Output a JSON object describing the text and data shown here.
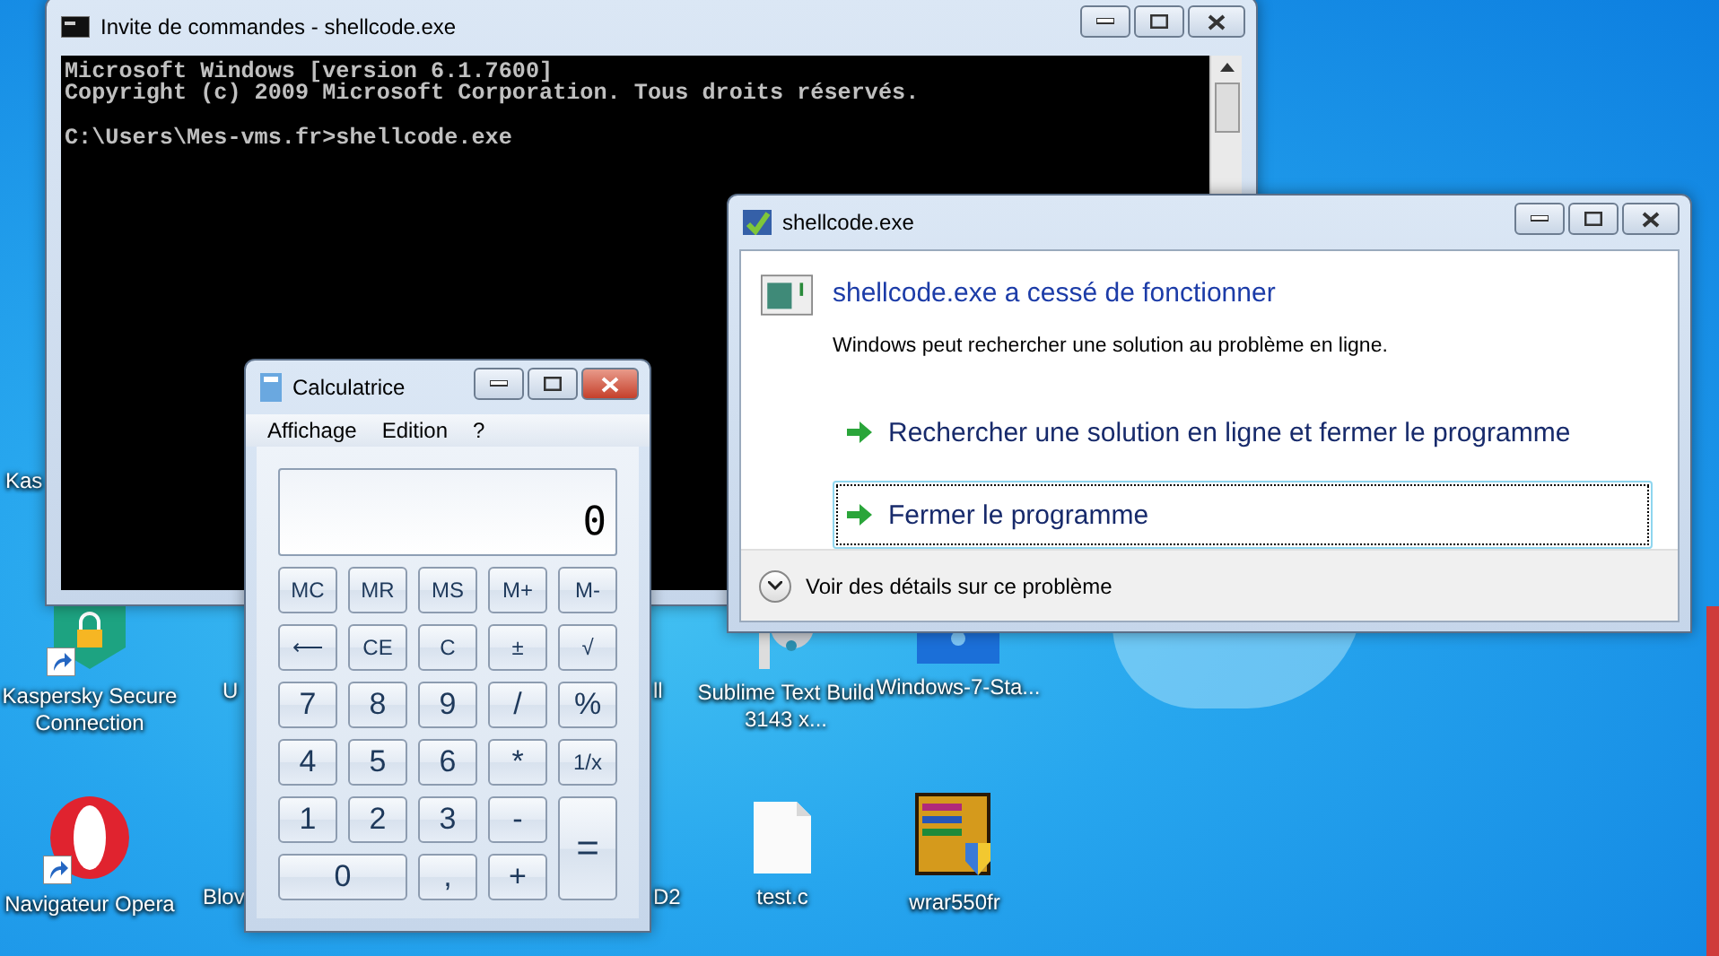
{
  "desktop": {
    "icons": [
      {
        "label": "Kaspersky Secure Connection",
        "kind": "kaspersky"
      },
      {
        "label": "Sublime Text Build 3143 x...",
        "kind": "disc"
      },
      {
        "label": "Windows-7-Sta...",
        "kind": "windows"
      },
      {
        "label": "Navigateur Opera",
        "kind": "opera"
      },
      {
        "label": "test.c",
        "kind": "file"
      },
      {
        "label": "wrar550fr",
        "kind": "archive"
      }
    ],
    "partial_labels": [
      "Kas",
      "U",
      "ll",
      "Blov",
      "D2"
    ]
  },
  "console": {
    "title": "Invite de commandes - shellcode.exe",
    "lines": [
      "Microsoft Windows [version 6.1.7600]",
      "Copyright (c) 2009 Microsoft Corporation. Tous droits réservés."
    ],
    "prompt": "C:\\Users\\Mes-vms.fr>shellcode.exe"
  },
  "calculator": {
    "title": "Calculatrice",
    "menu": [
      "Affichage",
      "Edition",
      "?"
    ],
    "display": "0",
    "buttons": [
      {
        "label": "MC",
        "kind": "normal"
      },
      {
        "label": "MR",
        "kind": "normal"
      },
      {
        "label": "MS",
        "kind": "normal"
      },
      {
        "label": "M+",
        "kind": "normal"
      },
      {
        "label": "M-",
        "kind": "normal"
      },
      {
        "label": "⟵",
        "kind": "normal"
      },
      {
        "label": "CE",
        "kind": "normal"
      },
      {
        "label": "C",
        "kind": "normal"
      },
      {
        "label": "±",
        "kind": "normal"
      },
      {
        "label": "√",
        "kind": "normal"
      },
      {
        "label": "7",
        "kind": "normal"
      },
      {
        "label": "8",
        "kind": "normal"
      },
      {
        "label": "9",
        "kind": "normal"
      },
      {
        "label": "/",
        "kind": "normal"
      },
      {
        "label": "%",
        "kind": "normal"
      },
      {
        "label": "4",
        "kind": "normal"
      },
      {
        "label": "5",
        "kind": "normal"
      },
      {
        "label": "6",
        "kind": "normal"
      },
      {
        "label": "*",
        "kind": "normal"
      },
      {
        "label": "1/x",
        "kind": "normal"
      },
      {
        "label": "1",
        "kind": "normal"
      },
      {
        "label": "2",
        "kind": "normal"
      },
      {
        "label": "3",
        "kind": "normal"
      },
      {
        "label": "-",
        "kind": "normal"
      },
      {
        "label": "=",
        "kind": "tall"
      },
      {
        "label": "0",
        "kind": "wide"
      },
      {
        "label": ",",
        "kind": "normal"
      },
      {
        "label": "+",
        "kind": "normal"
      }
    ]
  },
  "dialog": {
    "title": "shellcode.exe",
    "heading": "shellcode.exe a cessé de fonctionner",
    "message": "Windows peut rechercher une solution au problème en ligne.",
    "options": [
      {
        "label": "Rechercher une solution en ligne et fermer le programme",
        "focused": false
      },
      {
        "label": "Fermer le programme",
        "focused": true
      }
    ],
    "details": "Voir des détails sur ce problème"
  }
}
